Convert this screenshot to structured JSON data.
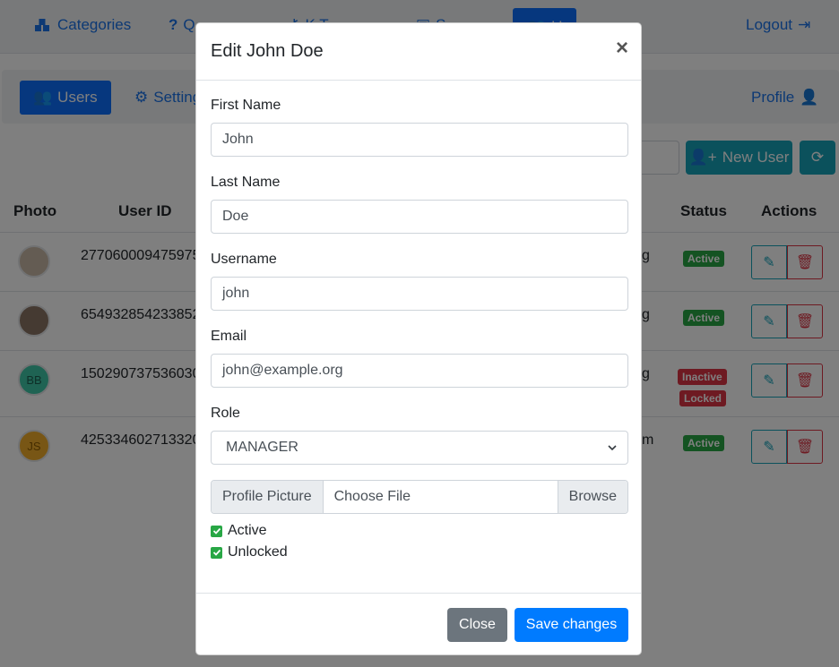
{
  "topnav": {
    "categories": "Categories",
    "questions": "Q",
    "key_terms": "K  T",
    "s_item": "S",
    "users": "U",
    "logout": "Logout"
  },
  "subnav": {
    "users": "Users",
    "settings": "Settings",
    "profile": "Profile"
  },
  "toolbar": {
    "new_user": "New User"
  },
  "table": {
    "headers": {
      "photo": "Photo",
      "user_id": "User ID",
      "status": "Status",
      "actions": "Actions"
    },
    "rows": [
      {
        "uid": "277060009475975",
        "trail": "g",
        "status": [
          "Active"
        ],
        "avatar_text": ""
      },
      {
        "uid": "654932854233852",
        "trail": "g",
        "status": [
          "Active"
        ],
        "avatar_text": ""
      },
      {
        "uid": "150290737536030",
        "trail": "g",
        "status": [
          "Inactive",
          "Locked"
        ],
        "avatar_text": "BB"
      },
      {
        "uid": "425334602713320",
        "trail": "m",
        "status": [
          "Active"
        ],
        "avatar_text": "JS"
      }
    ]
  },
  "modal": {
    "title": "Edit John Doe",
    "close_symbol": "×",
    "first_name_label": "First Name",
    "first_name_value": "John",
    "last_name_label": "Last Name",
    "last_name_value": "Doe",
    "username_label": "Username",
    "username_value": "john",
    "email_label": "Email",
    "email_value": "john@example.org",
    "role_label": "Role",
    "role_value": "MANAGER",
    "profile_picture_label": "Profile Picture",
    "file_placeholder": "Choose File",
    "browse_label": "Browse",
    "active_label": "Active",
    "unlocked_label": "Unlocked",
    "close_button": "Close",
    "save_button": "Save changes"
  },
  "colors": {
    "primary": "#007bff",
    "teal": "#17a2b8",
    "success": "#28a745",
    "danger": "#dc3545",
    "secondary": "#6c757d"
  }
}
